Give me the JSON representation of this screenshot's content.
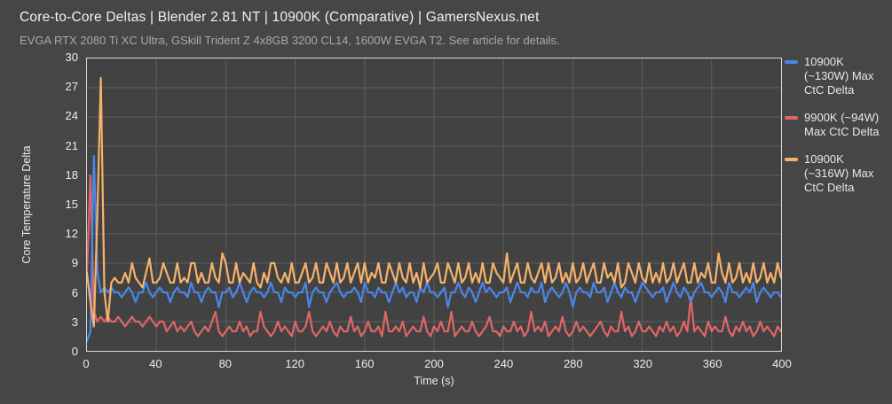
{
  "header": {
    "title": "Core-to-Core Deltas | Blender 2.81 NT | 10900K (Comparative) | GamersNexus.net",
    "subtitle": "EVGA RTX 2080 Ti XC Ultra, GSkill Trident Z 4x8GB 3200 CL14, 1600W EVGA T2. See article for details."
  },
  "colors": {
    "background": "#464646",
    "plot_background": "#424242",
    "grid": "#5e5e5e",
    "plot_border": "#d9d9d9",
    "title_text": "#f2f2f2",
    "subtitle_text": "#a9a9a9",
    "tick_text": "#ededed",
    "series_blue": "#4a86e8",
    "series_red": "#e06666",
    "series_orange": "#f6b26b"
  },
  "legend": {
    "position": "right",
    "items": [
      {
        "label": "10900K\n(~130W) Max\nCtC Delta",
        "color": "#4a86e8"
      },
      {
        "label": "9900K (~94W)\nMax CtC Delta",
        "color": "#e06666"
      },
      {
        "label": "10900K\n(~316W) Max\nCtC Delta",
        "color": "#f6b26b"
      }
    ]
  },
  "chart_data": {
    "type": "line",
    "title": "Core-to-Core Deltas | Blender 2.81 NT | 10900K (Comparative) | GamersNexus.net",
    "subtitle": "EVGA RTX 2080 Ti XC Ultra, GSkill Trident Z 4x8GB 3200 CL14, 1600W EVGA T2. See article for details.",
    "xlabel": "Time (s)",
    "ylabel": "Core Temperature Delta",
    "xlim": [
      0,
      400
    ],
    "ylim": [
      0,
      30
    ],
    "x_ticks": [
      0,
      40,
      80,
      120,
      160,
      200,
      240,
      280,
      320,
      360,
      400
    ],
    "y_ticks": [
      0,
      3,
      6,
      9,
      12,
      15,
      18,
      21,
      24,
      27,
      30
    ],
    "grid": true,
    "legend_position": "right",
    "x": {
      "start": 0,
      "step": 2,
      "count": 201
    },
    "series": [
      {
        "name": "9900K (~94W) Max CtC Delta",
        "color_key": "series_red",
        "values": [
          8,
          18,
          4,
          3,
          3.5,
          3,
          3.5,
          3,
          3,
          3.5,
          3,
          2.5,
          3,
          3.5,
          3,
          3,
          2.5,
          3,
          3.5,
          3,
          2.5,
          3,
          3,
          2,
          2.5,
          3,
          2,
          2.5,
          2,
          2.5,
          3,
          2,
          1.5,
          2,
          2.5,
          2,
          3,
          4,
          2,
          1.5,
          2,
          2.5,
          2,
          2,
          3,
          2,
          2.5,
          1.5,
          2,
          2,
          4,
          2.5,
          2,
          1.5,
          2,
          3,
          2,
          2.5,
          2,
          1.5,
          3,
          2,
          2,
          2.5,
          4,
          2,
          1.5,
          2,
          2.5,
          2,
          3,
          2,
          1.5,
          2.5,
          2,
          2,
          3.5,
          2,
          2.5,
          1.5,
          2,
          3,
          2,
          2,
          2.5,
          1.5,
          4,
          2,
          2,
          2.5,
          2,
          3,
          1.5,
          2,
          2.5,
          2,
          2,
          3.5,
          2,
          1.5,
          2.5,
          2,
          3,
          2,
          2,
          4,
          1.5,
          2,
          2.5,
          2,
          2,
          3,
          2,
          1.5,
          2,
          2.5,
          3.5,
          2,
          2,
          1.5,
          2.5,
          2,
          2,
          3,
          2,
          2.5,
          1.5,
          2,
          4,
          2,
          2.5,
          2,
          3,
          1.5,
          2,
          2.5,
          2,
          3.5,
          2,
          1.5,
          2,
          3,
          2,
          2.5,
          2,
          1.5,
          2,
          2.5,
          3,
          2,
          1.5,
          2.5,
          2,
          2,
          4,
          2,
          2.5,
          1.5,
          2,
          3,
          2,
          2,
          2.5,
          2,
          1.5,
          2.5,
          2,
          3,
          2,
          2.5,
          1.5,
          2,
          3,
          2,
          5.5,
          2,
          2.5,
          2,
          1.5,
          3,
          2,
          2.5,
          2,
          2,
          3.5,
          2,
          1.5,
          2.5,
          2,
          3,
          2,
          2.5,
          1.5,
          2,
          3,
          2,
          2.5,
          2,
          1.5,
          2.5,
          2
        ]
      },
      {
        "name": "10900K (~130W) Max CtC Delta",
        "color_key": "series_blue",
        "values": [
          1,
          2,
          20,
          8,
          6,
          6.5,
          6,
          6.5,
          6,
          6,
          5.5,
          6,
          6.5,
          6,
          5,
          6,
          6,
          7,
          6,
          5.5,
          6,
          6.5,
          6,
          6,
          5,
          6,
          6.5,
          6,
          6,
          5.5,
          7,
          6,
          6,
          5,
          6,
          6.5,
          6,
          6,
          4.5,
          6,
          6,
          6.5,
          5.5,
          6,
          7,
          6,
          5,
          6,
          6.5,
          6,
          6,
          5.5,
          6,
          7,
          6,
          6,
          5,
          6.5,
          6,
          6,
          5.5,
          6,
          6,
          7,
          4.5,
          6,
          6.5,
          6,
          6,
          5,
          6,
          6.5,
          7,
          6,
          5.5,
          6,
          6,
          6.5,
          6,
          5,
          7,
          6,
          6,
          5.5,
          6.5,
          6,
          6,
          5,
          6,
          7,
          6,
          6.5,
          5.5,
          6,
          6,
          5,
          6.5,
          6,
          7,
          6,
          6,
          5.5,
          6,
          6.5,
          4.5,
          6,
          6,
          7,
          6,
          5.5,
          6.5,
          6,
          5,
          6,
          7,
          6,
          6.5,
          6,
          5.5,
          6,
          6,
          6.5,
          5,
          6,
          7,
          6,
          6,
          5.5,
          6.5,
          6,
          6,
          7,
          5,
          6,
          6.5,
          6,
          5.5,
          6,
          7,
          6,
          4.5,
          6,
          6.5,
          6,
          6,
          5.5,
          7,
          6,
          6,
          6.5,
          5,
          6,
          7,
          6,
          5.5,
          6.5,
          6,
          6,
          5,
          6,
          7,
          6.5,
          6,
          5.5,
          6,
          6,
          6.5,
          5,
          6,
          7,
          6,
          5.5,
          6.5,
          6,
          5,
          6,
          6.5,
          7,
          6,
          6,
          5.5,
          6,
          6.5,
          6,
          5,
          7,
          6,
          6,
          5.5,
          6,
          6.5,
          6,
          7,
          5,
          6,
          6.5,
          6,
          5.5,
          6,
          6,
          5.5
        ]
      },
      {
        "name": "10900K (~316W) Max CtC Delta",
        "color_key": "series_orange",
        "values": [
          8,
          5,
          2.5,
          14,
          28,
          6,
          3,
          7,
          7.5,
          7,
          7,
          8,
          7,
          9,
          7.5,
          7,
          6.5,
          8,
          9.5,
          7,
          7,
          7.5,
          9,
          8,
          7,
          7,
          9,
          7,
          7.5,
          7,
          9,
          9,
          7,
          8,
          7,
          7,
          9,
          7.5,
          7,
          10,
          9,
          7,
          7,
          9,
          7,
          8,
          7.5,
          7,
          9,
          7,
          6.5,
          8,
          7,
          9,
          9,
          7.5,
          7,
          8,
          7,
          9,
          7,
          7,
          8,
          9,
          7,
          7.5,
          9,
          7,
          7,
          9,
          8,
          7,
          9,
          7,
          7.5,
          9,
          7,
          8,
          9,
          7,
          9,
          7,
          8,
          7.5,
          9,
          7,
          7,
          9,
          8,
          7,
          9,
          7.5,
          7,
          9,
          7,
          8,
          6.5,
          9,
          7,
          7.5,
          8,
          9,
          7,
          7,
          9,
          8,
          7,
          9,
          7,
          7.5,
          9,
          7,
          8,
          7,
          9,
          7,
          7,
          9,
          8,
          7.5,
          7,
          10,
          7,
          8,
          9,
          7,
          7,
          9,
          7.5,
          7,
          8,
          9,
          7,
          9,
          7,
          7.5,
          9,
          7,
          8,
          7,
          9,
          7,
          7.5,
          9,
          7,
          8,
          9,
          7,
          7,
          9,
          7.5,
          8,
          7,
          9,
          6.5,
          7,
          9,
          8,
          7,
          9,
          7.5,
          7,
          9,
          7,
          8,
          7,
          9,
          7,
          7.5,
          9,
          7,
          8,
          9,
          7,
          7,
          9,
          7,
          8,
          7.5,
          9,
          7,
          7,
          10,
          8,
          7,
          9,
          7,
          7.5,
          9,
          7,
          8,
          7,
          9,
          7,
          7.5,
          9,
          7,
          8,
          7,
          9,
          7.5
        ]
      }
    ]
  }
}
